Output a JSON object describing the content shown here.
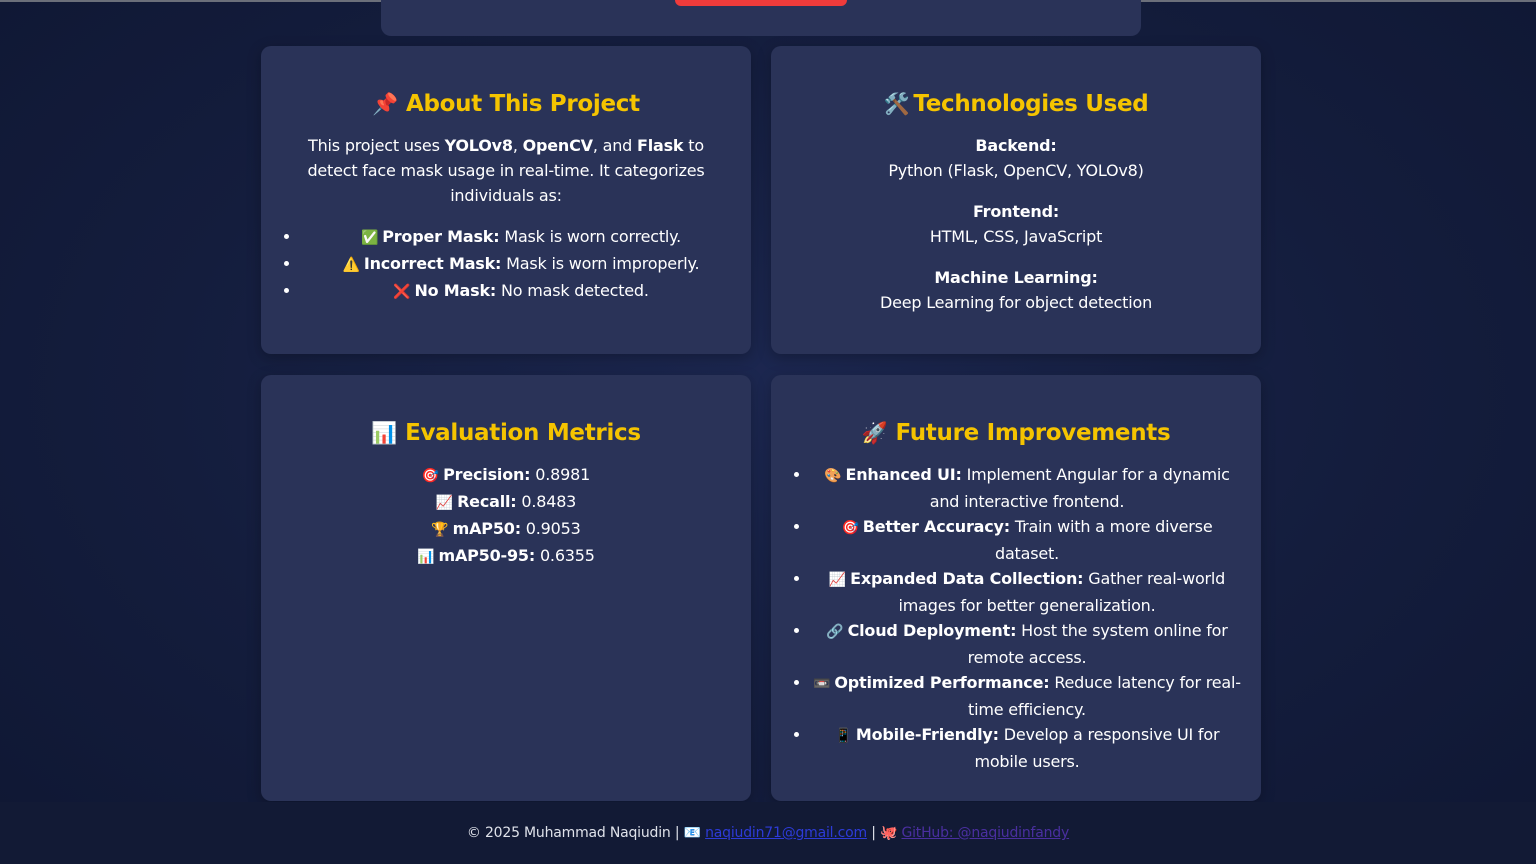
{
  "about": {
    "icon": "📌",
    "title": "About This Project",
    "intro": {
      "pre": "This project uses ",
      "t1": "YOLOv8",
      "s1": ", ",
      "t2": "OpenCV",
      "s2": ", and ",
      "t3": "Flask",
      "post": " to detect face mask usage in real-time. It categorizes individuals as:"
    },
    "items": [
      {
        "icon": "✅",
        "label": "Proper Mask:",
        "text": " Mask is worn correctly."
      },
      {
        "icon": "⚠️",
        "label": "Incorrect Mask:",
        "text": " Mask is worn improperly."
      },
      {
        "icon": "❌",
        "label": "No Mask:",
        "text": " No mask detected."
      }
    ]
  },
  "tech": {
    "icon": "🛠️",
    "title": "Technologies Used",
    "groups": [
      {
        "label": "Backend:",
        "value": "Python (Flask, OpenCV, YOLOv8)"
      },
      {
        "label": "Frontend:",
        "value": "HTML, CSS, JavaScript"
      },
      {
        "label": "Machine Learning:",
        "value": "Deep Learning for object detection"
      }
    ]
  },
  "metrics": {
    "icon": "📊",
    "title": "Evaluation Metrics",
    "items": [
      {
        "icon": "🎯",
        "label": "Precision:",
        "value": " 0.8981"
      },
      {
        "icon": "📈",
        "label": "Recall:",
        "value": " 0.8483"
      },
      {
        "icon": "🏆",
        "label": "mAP50:",
        "value": " 0.9053"
      },
      {
        "icon": "📊",
        "label": "mAP50-95:",
        "value": " 0.6355"
      }
    ]
  },
  "future": {
    "icon": "🚀",
    "title": "Future Improvements",
    "items": [
      {
        "icon": "🎨",
        "label": "Enhanced UI:",
        "text": " Implement Angular for a dynamic and interactive frontend."
      },
      {
        "icon": "🎯",
        "label": "Better Accuracy:",
        "text": " Train with a more diverse dataset."
      },
      {
        "icon": "📈",
        "label": "Expanded Data Collection:",
        "text": " Gather real-world images for better generalization."
      },
      {
        "icon": "🔗",
        "label": "Cloud Deployment:",
        "text": " Host the system online for remote access."
      },
      {
        "icon": "📼",
        "label": "Optimized Performance:",
        "text": " Reduce latency for real-time efficiency."
      },
      {
        "icon": "📱",
        "label": "Mobile-Friendly:",
        "text": " Develop a responsive UI for mobile users."
      }
    ]
  },
  "footer": {
    "copyright": "© 2025 Muhammad Naqiudin | ",
    "mail_icon": "📧",
    "email": "naqiudin71@gmail.com",
    "sep": " | ",
    "gh_icon": "🐙",
    "github": "GitHub: @naqiudinfandy"
  },
  "colors": {
    "accent_title": "#f5c400",
    "card_bg": "#2a3358",
    "top_accent": "#ef3b3b"
  }
}
